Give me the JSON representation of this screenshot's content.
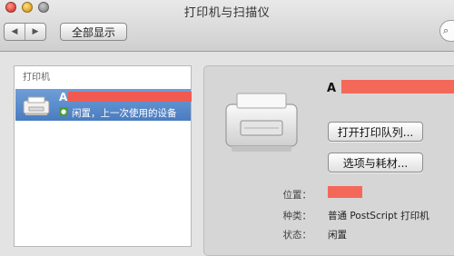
{
  "window": {
    "title": "打印机与扫描仪"
  },
  "toolbar": {
    "back_glyph": "◀",
    "forward_glyph": "▶",
    "show_all_label": "全部显示",
    "search_glyph": "⌕"
  },
  "printer_list": {
    "header": "打印机",
    "items": [
      {
        "name": "A",
        "status": "闲置，上一次使用的设备",
        "icon": "printer-icon",
        "selected": true
      }
    ]
  },
  "detail": {
    "printer_name": "A",
    "open_queue_button": "打开打印队列...",
    "options_button": "选项与耗材...",
    "fields": [
      {
        "label": "位置：",
        "value": ""
      },
      {
        "label": "种类：",
        "value": "普通 PostScript 打印机"
      },
      {
        "label": "状态：",
        "value": "闲置"
      }
    ]
  },
  "colors": {
    "selection": "#5b8ccc",
    "redaction": "#f4685a",
    "window_bg": "#e3e3e3"
  }
}
